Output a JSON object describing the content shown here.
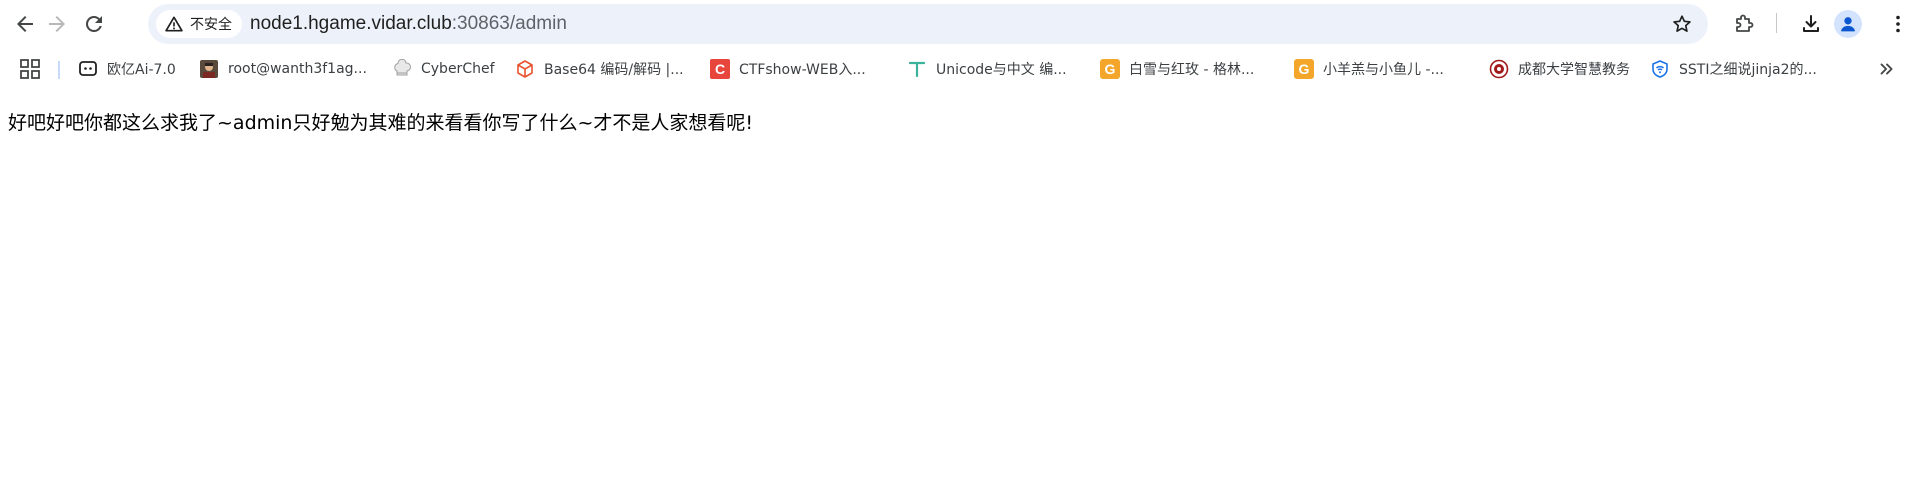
{
  "toolbar": {
    "back_icon": "arrow-left-icon",
    "forward_icon": "arrow-right-icon",
    "reload_icon": "reload-icon",
    "security_chip": "不安全",
    "url_host": "node1.hgame.vidar.club",
    "url_path": ":30863/admin",
    "colors": {
      "omnibox_bg": "#edf2fa",
      "avatar_bg": "#d3e3fd",
      "avatar_fg": "#0b57d0"
    }
  },
  "bookmarks": {
    "items": [
      {
        "label": "欧亿Ai-7.0",
        "icon": "chat-icon"
      },
      {
        "label": "root@wanth3f1ag...",
        "icon": "avatar-photo-icon"
      },
      {
        "label": "CyberChef",
        "icon": "chef-hat-icon"
      },
      {
        "label": "Base64 编码/解码 |...",
        "icon": "cube-icon"
      },
      {
        "label": "CTFshow-WEB入...",
        "icon": "c-logo-icon"
      },
      {
        "label": "Unicode与中文 编...",
        "icon": "t-letter-icon"
      },
      {
        "label": "白雪与红玫 - 格林...",
        "icon": "g-letter-icon"
      },
      {
        "label": "小羊羔与小鱼儿 -...",
        "icon": "g-letter-icon"
      },
      {
        "label": "成都大学智慧教务",
        "icon": "seal-icon"
      },
      {
        "label": "SSTI之细说jinja2的...",
        "icon": "shield-wifi-icon"
      }
    ]
  },
  "content": {
    "message": "好吧好吧你都这么求我了~admin只好勉为其难的来看看你写了什么~才不是人家想看呢!"
  }
}
